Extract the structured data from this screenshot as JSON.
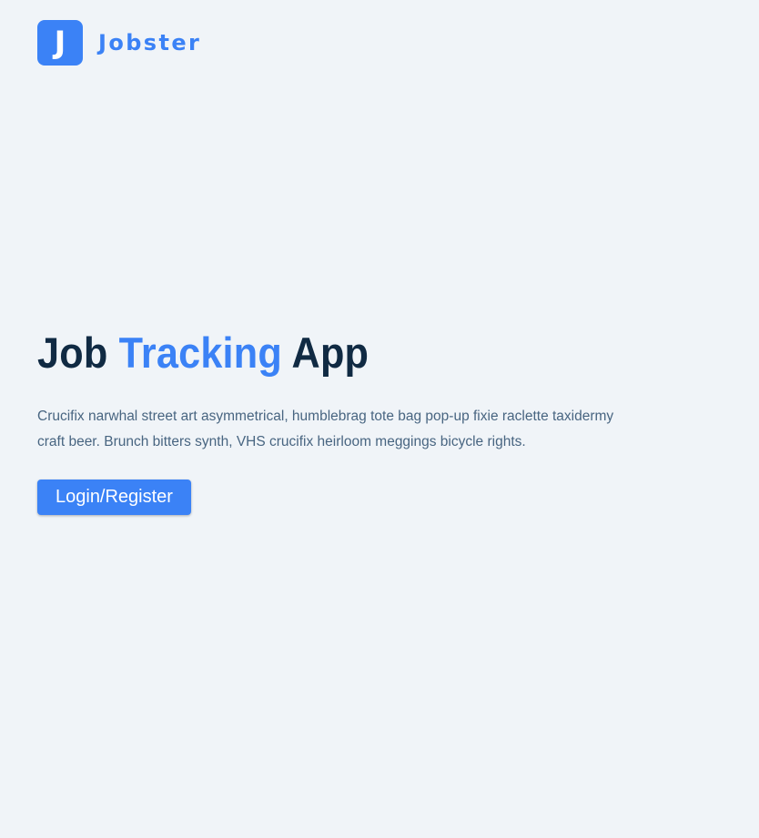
{
  "brand": {
    "logo_letter": "J",
    "name": "Jobster",
    "accent_color": "#3b82f6"
  },
  "hero": {
    "title_part1": "Job ",
    "title_highlight": "Tracking",
    "title_part2": " App",
    "description": "Crucifix narwhal street art asymmetrical, humblebrag tote bag pop-up fixie raclette taxidermy craft beer. Brunch bitters synth, VHS crucifix heirloom meggings bicycle rights.",
    "cta_label": "Login/Register"
  },
  "colors": {
    "background": "#f0f4f8",
    "heading": "#102a43",
    "body_text": "#486581",
    "primary": "#3b82f6"
  }
}
